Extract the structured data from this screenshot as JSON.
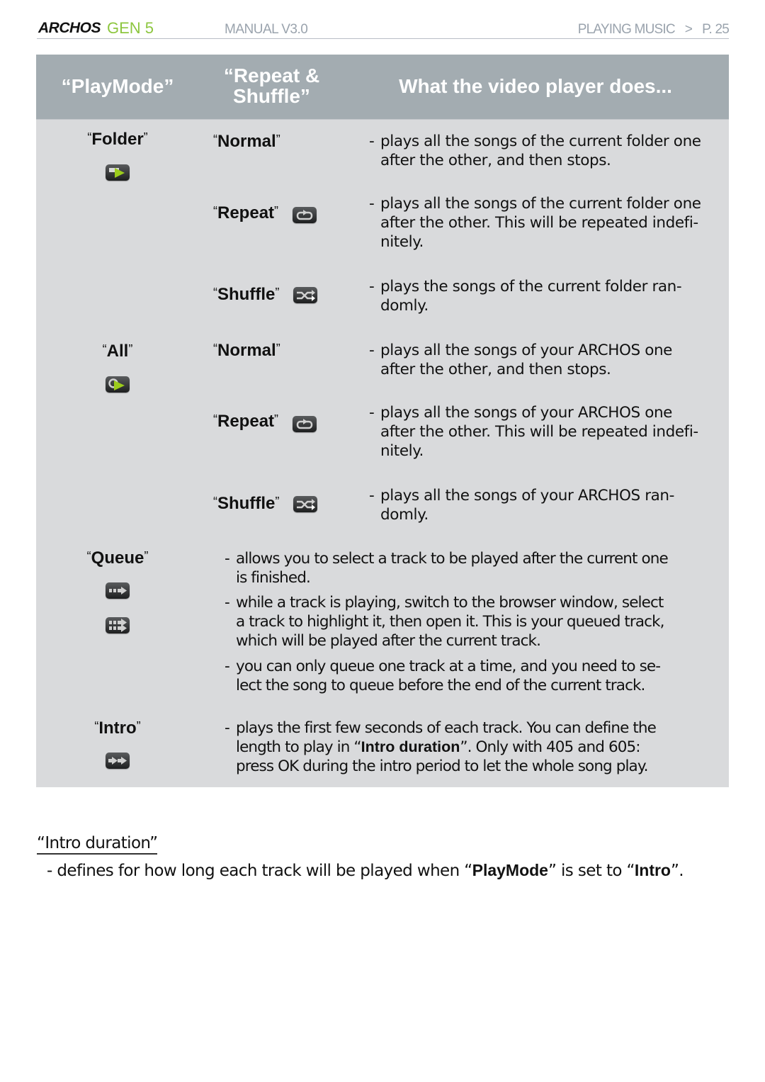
{
  "header": {
    "brand": "ARCHOS",
    "model": "GEN 5",
    "manual": "MANUAL V3.0",
    "section": "PLAYING MUSIC",
    "separator": ">",
    "page": "P. 25"
  },
  "table": {
    "columns": [
      "“PlayMode”",
      "“Repeat & Shuffle”",
      "What the video player does..."
    ],
    "column_repeat_line1": "“Repeat &",
    "column_repeat_line2": "Shuffle”",
    "rows": {
      "folder": {
        "label": "Folder",
        "icon": "folder-play-icon",
        "normal": {
          "label": "Normal",
          "desc": [
            "plays all the songs of the current folder one",
            "after the other, and then stops."
          ]
        },
        "repeat": {
          "label": "Repeat",
          "icon": "repeat-icon",
          "desc": [
            "plays all the songs of the current folder one",
            "after the other. This will be repeated indefi-",
            "nitely."
          ]
        },
        "shuffle": {
          "label": "Shuffle",
          "icon": "shuffle-icon",
          "desc": [
            "plays the songs of the current folder ran-",
            "domly."
          ]
        }
      },
      "all": {
        "label": "All",
        "icon": "all-play-icon",
        "normal": {
          "label": "Normal",
          "desc": [
            "plays all the songs of your ARCHOS one",
            "after the other, and then stops."
          ]
        },
        "repeat": {
          "label": "Repeat",
          "icon": "repeat-icon",
          "desc": [
            "plays all the songs of your ARCHOS one",
            "after the other. This will be repeated indefi-",
            "nitely."
          ]
        },
        "shuffle": {
          "label": "Shuffle",
          "icon": "shuffle-icon",
          "desc": [
            "plays all the songs of your ARCHOS ran-",
            "domly."
          ]
        }
      },
      "queue": {
        "label": "Queue",
        "icons": [
          "queue-icon",
          "queue-double-icon"
        ],
        "bullets": [
          [
            "allows you to select a track to be played after the current one",
            "is finished."
          ],
          [
            "while a track is playing, switch to the browser window, select",
            "a track to highlight it, then open it. This is your queued track,",
            "which will be played after the current track."
          ],
          [
            "you can only queue one track at a time, and you need to se-",
            "lect the song to queue before the end of the current track."
          ]
        ]
      },
      "intro": {
        "label": "Intro",
        "icon": "intro-icon",
        "desc_line1": "plays the first few seconds of each track. You can define the",
        "desc_line2_pre": "length to play in “",
        "desc_line2_bold": "Intro duration",
        "desc_line2_post": "”. Only with 405 and 605:",
        "desc_line3": "press OK during the intro period to let the whole song play."
      }
    }
  },
  "intro_duration": {
    "title": "“Intro duration”",
    "desc_pre": "- defines for how long each track will be played when “",
    "desc_bold1": "PlayMode",
    "desc_mid": "” is set to “",
    "desc_bold2": "Intro",
    "desc_post": "”."
  }
}
